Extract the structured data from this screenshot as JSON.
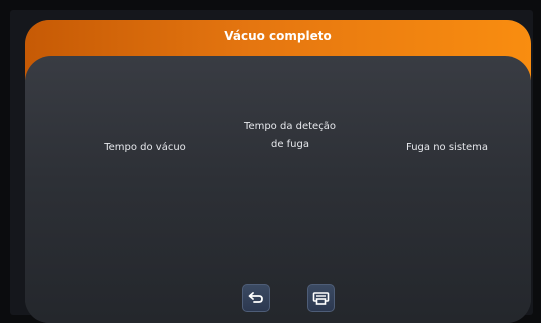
{
  "header": {
    "title": "Vácuo completo"
  },
  "fields": {
    "vacuum_time_label": "Tempo do vácuo",
    "leak_detection_time_label_line1": "Tempo da deteção",
    "leak_detection_time_label_line2": "de fuga",
    "system_leak_label": "Fuga no sistema"
  },
  "buttons": [
    {
      "name": "back-button",
      "icon": "return-arrow-icon"
    },
    {
      "name": "print-button",
      "icon": "printer-icon"
    }
  ],
  "colors": {
    "header_start": "#c65a05",
    "header_end": "#f98d10",
    "panel": "#2d3036",
    "button": "#34425a"
  }
}
